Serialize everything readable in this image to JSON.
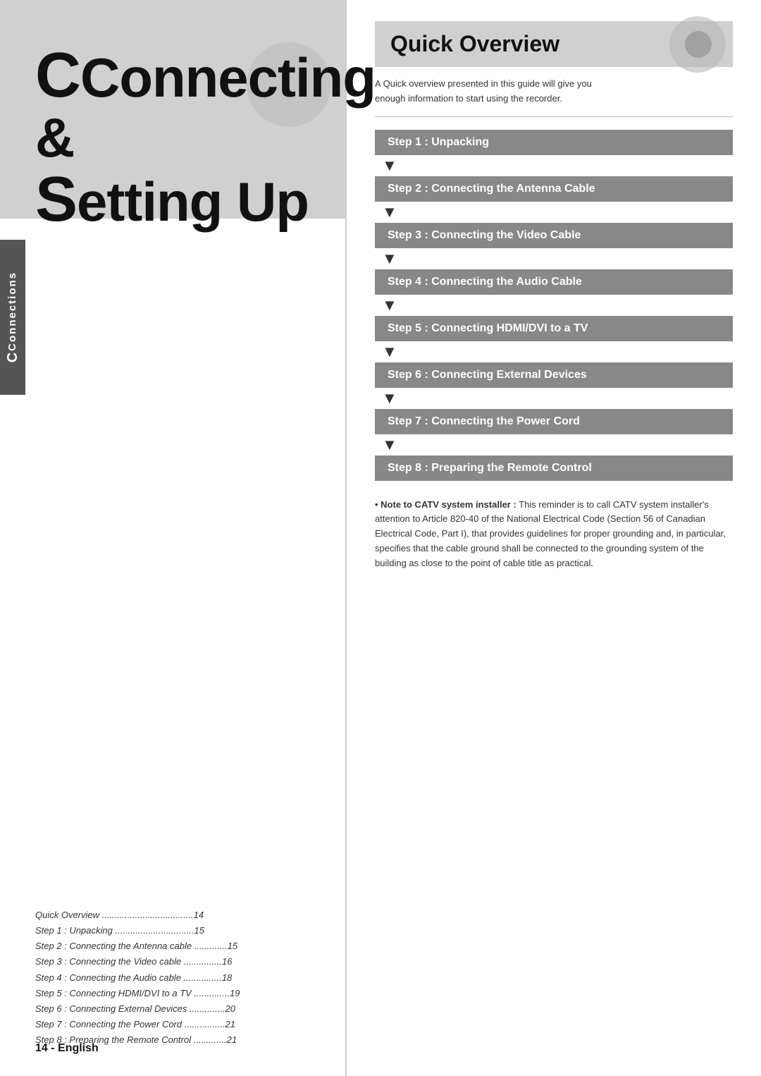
{
  "left": {
    "title_line1": "Connecting &",
    "title_line2": "Setting Up",
    "connections_tab": "Connections",
    "toc": [
      {
        "label": "Quick Overview",
        "dots": "...............................",
        "page": "14"
      },
      {
        "label": "Step 1 : Unpacking",
        "dots": "...............................",
        "page": "15"
      },
      {
        "label": "Step 2 : Connecting the Antenna cable",
        "dots": ".............",
        "page": "15"
      },
      {
        "label": "Step 3 : Connecting the Video cable",
        "dots": ".............",
        "page": "16"
      },
      {
        "label": "Step 4 : Connecting the Audio cable",
        "dots": ".............",
        "page": "18"
      },
      {
        "label": "Step 5 : Connecting HDMI/DVI to a TV",
        "dots": "...........",
        "page": "19"
      },
      {
        "label": "Step 6 : Connecting External Devices",
        "dots": "............",
        "page": "20"
      },
      {
        "label": "Step 7 : Connecting the Power Cord",
        "dots": ".............",
        "page": "21"
      },
      {
        "label": "Step 8 : Preparing the Remote Control",
        "dots": "............",
        "page": "21"
      }
    ],
    "page_number": "14 - English"
  },
  "right": {
    "quick_overview": {
      "title": "Quick Overview",
      "description_line1": "A Quick overview presented in this guide will give you",
      "description_line2": "enough information to start using the recorder."
    },
    "steps": [
      {
        "id": "step1",
        "label": "Step 1 : Unpacking"
      },
      {
        "id": "step2",
        "label": "Step 2 : Connecting the Antenna Cable"
      },
      {
        "id": "step3",
        "label": "Step 3 : Connecting the Video Cable"
      },
      {
        "id": "step4",
        "label": "Step 4 : Connecting the Audio Cable"
      },
      {
        "id": "step5",
        "label": "Step 5 : Connecting HDMI/DVI to a TV"
      },
      {
        "id": "step6",
        "label": "Step 6 : Connecting External Devices"
      },
      {
        "id": "step7",
        "label": "Step 7 : Connecting the Power Cord"
      },
      {
        "id": "step8",
        "label": "Step 8 : Preparing the Remote Control"
      }
    ],
    "note": {
      "prefix": "Note to CATV system installer :",
      "text": " This reminder is to call CATV system installer's attention to Article 820-40 of the National Electrical Code (Section 56 of Canadian Electrical Code, Part I), that provides guidelines for proper grounding and, in particular, specifies that the cable ground shall be connected to the grounding system of the building as close to the point of cable title as practical."
    }
  }
}
